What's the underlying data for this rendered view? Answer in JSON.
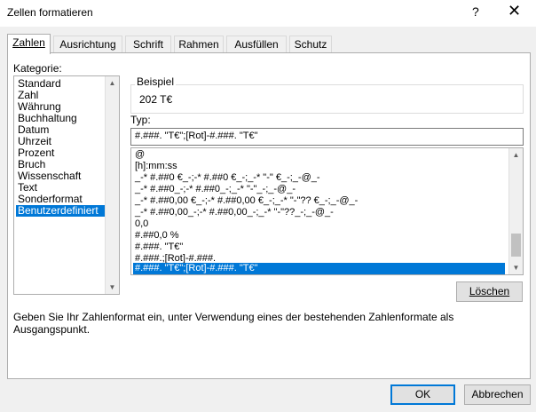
{
  "window": {
    "title": "Zellen formatieren",
    "help_label": "?",
    "close_label": "✕"
  },
  "tabs": [
    {
      "label": "Zahlen",
      "active": true
    },
    {
      "label": "Ausrichtung"
    },
    {
      "label": "Schrift"
    },
    {
      "label": "Rahmen"
    },
    {
      "label": "Ausfüllen"
    },
    {
      "label": "Schutz"
    }
  ],
  "category": {
    "label": "Kategorie:",
    "items": [
      "Standard",
      "Zahl",
      "Währung",
      "Buchhaltung",
      "Datum",
      "Uhrzeit",
      "Prozent",
      "Bruch",
      "Wissenschaft",
      "Text",
      "Sonderformat",
      "Benutzerdefiniert"
    ],
    "selected": "Benutzerdefiniert"
  },
  "example": {
    "label": "Beispiel",
    "value": "202 T€"
  },
  "type": {
    "label": "Typ:",
    "value": "#.###. \"T€\";[Rot]-#.###. \"T€\"",
    "formats": [
      "@",
      "[h]:mm:ss",
      "_-* #.##0 €_-;-* #.##0 €_-;_-* \"-\" €_-;_-@_-",
      "_-* #.##0_-;-* #.##0_-;_-* \"-\"_-;_-@_-",
      "_-* #.##0,00 €_-;-* #.##0,00 €_-;_-* \"-\"?? €_-;_-@_-",
      "_-* #.##0,00_-;-* #.##0,00_-;_-* \"-\"??_-;_-@_-",
      "0,0",
      "#.##0,0 %",
      "#.###. \"T€\"",
      "#.###.;[Rot]-#.###.",
      "#.###. \"T€\";[Rot]-#.###. \"T€\""
    ]
  },
  "buttons": {
    "delete": "Löschen",
    "ok": "OK",
    "cancel": "Abbrechen"
  },
  "hint": "Geben Sie Ihr Zahlenformat ein, unter Verwendung eines der bestehenden Zahlenformate als Ausgangspunkt.",
  "colors": {
    "selection": "#0078d7",
    "panel": "#ffffff",
    "dialog": "#f0f0f0"
  }
}
